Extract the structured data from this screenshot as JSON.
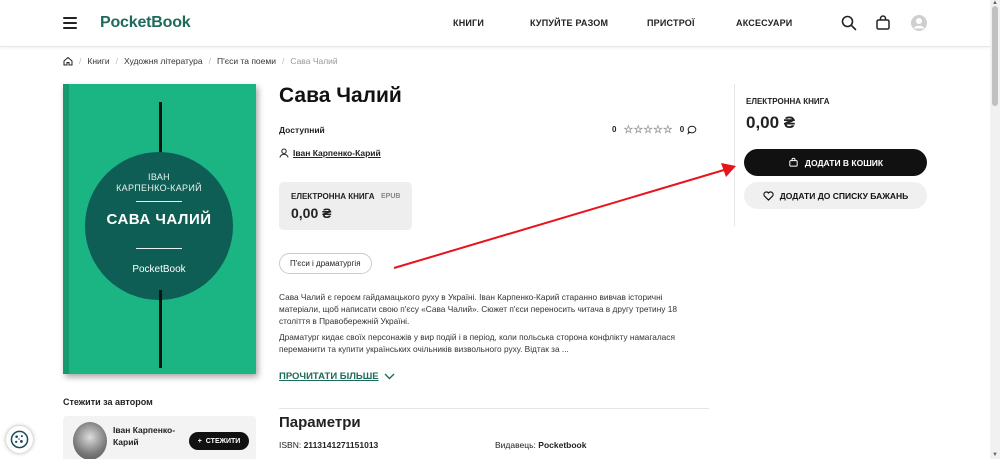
{
  "header": {
    "logo": "PocketBook",
    "nav": [
      "КНИГИ",
      "КУПУЙТЕ РАЗОМ",
      "ПРИСТРОЇ",
      "АКСЕСУАРИ"
    ]
  },
  "breadcrumb": {
    "items": [
      "Книги",
      "Художня література",
      "П'єси та поеми"
    ],
    "current": "Сава Чалий"
  },
  "cover": {
    "author_line1": "ІВАН",
    "author_line2": "КАРПЕНКО-КАРИЙ",
    "title": "САВА ЧАЛИЙ",
    "publisher": "PocketBook",
    "colors": {
      "background": "#1bb584",
      "circle": "#0f5e55"
    }
  },
  "follow": {
    "title": "Стежити за автором",
    "author_name": "Іван Карпенко-Карий",
    "button": "СТЕЖИТИ"
  },
  "product": {
    "title": "Сава Чалий",
    "availability": "Доступний",
    "rating_value": "0",
    "rating_stars": 0,
    "reviews_count": "0",
    "author": "Іван Карпенко-Карий",
    "format": {
      "label": "ЕЛЕКТРОННА КНИГА",
      "type": "EPUB",
      "price": "0,00 ₴"
    },
    "genre_tag": "П'єси і драматургія",
    "description_p1": "Сава Чалий є героєм гайдамацького руху в Україні. Іван Карпенко-Карий старанно вивчав історичні матеріали, щоб написати свою п'єсу «Сава Чалий». Сюжет п'єси переносить читача в другу третину 18 століття в Правобережній Україні.",
    "description_p2": "Драматург кидає своїх персонажів у вир подій і в період, коли польська сторона конфлікту намагалася переманити та купити українських очільників визвольного руху. Відтак за ...",
    "read_more": "ПРОЧИТАТИ БІЛЬШЕ"
  },
  "params": {
    "title": "Параметри",
    "isbn_label": "ISBN:",
    "isbn_value": "2113141271151013",
    "publisher_label": "Видавець:",
    "publisher_value": "Pocketbook"
  },
  "buy_panel": {
    "label": "ЕЛЕКТРОННА КНИГА",
    "price": "0,00 ₴",
    "cart_button": "ДОДАТИ В КОШИК",
    "wishlist_button": "ДОДАТИ ДО СПИСКУ БАЖАНЬ"
  },
  "annotation": {
    "arrow_color": "#e8141c"
  }
}
